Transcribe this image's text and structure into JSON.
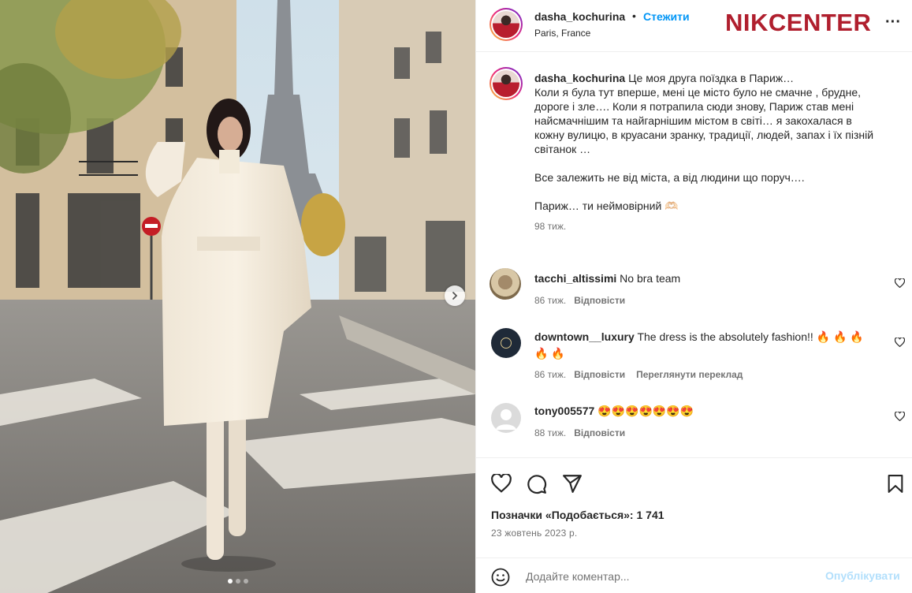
{
  "post": {
    "author": "dasha_kochurina",
    "follow_label": "Стежити",
    "separator": "•",
    "location": "Paris, France",
    "brand_logo": "NIKCENTER",
    "more_icon": "more-horizontal-icon",
    "more_label": "···"
  },
  "caption": {
    "author": "dasha_kochurina",
    "text": "Це моя друга поїздка в Париж…\nКоли я була тут вперше, мені це місто було не смачне , брудне, дороге і зле…. Коли я потрапила сюди знову, Париж став мені найсмачнішим та найгарнішим містом в світі… я закохалася в кожну вулицю, в круасани зранку, традиції, людей, запах і їх пізній світанок …\n\nВсе залежить не від міста, а від людини що поруч….\n\nПариж… ти неймовірний 🫶🏻",
    "time": "98 тиж."
  },
  "comments": [
    {
      "user": "tacchi_altissimi",
      "text": "No bra team",
      "time": "86 тиж.",
      "reply": "Відповісти"
    },
    {
      "user": "downtown__luxury",
      "text": "The dress is the absolutely fashion!! 🔥 🔥 🔥 🔥 🔥",
      "time": "86 тиж.",
      "reply": "Відповісти",
      "translate": "Переглянути переклад"
    },
    {
      "user": "tony005577",
      "text": "😍😍😍😍😍😍😍",
      "time": "88 тиж.",
      "reply": "Відповісти"
    }
  ],
  "actions": {
    "icons": [
      "heart-icon",
      "comment-icon",
      "share-icon",
      "bookmark-icon"
    ],
    "likes_label": "Позначки «Подобається»: 1 741",
    "date": "23 жовтень 2023 р."
  },
  "composer": {
    "placeholder": "Додайте коментар...",
    "publish_label": "Опублікувати",
    "emoji_icon": "emoji-icon"
  },
  "carousel": {
    "next_icon": "chevron-right-icon",
    "slides": 3,
    "active": 0
  },
  "colors": {
    "accent": "#0095f6",
    "brand": "#b01f2e",
    "muted": "#737373",
    "publish_disabled": "#b2dffc"
  }
}
